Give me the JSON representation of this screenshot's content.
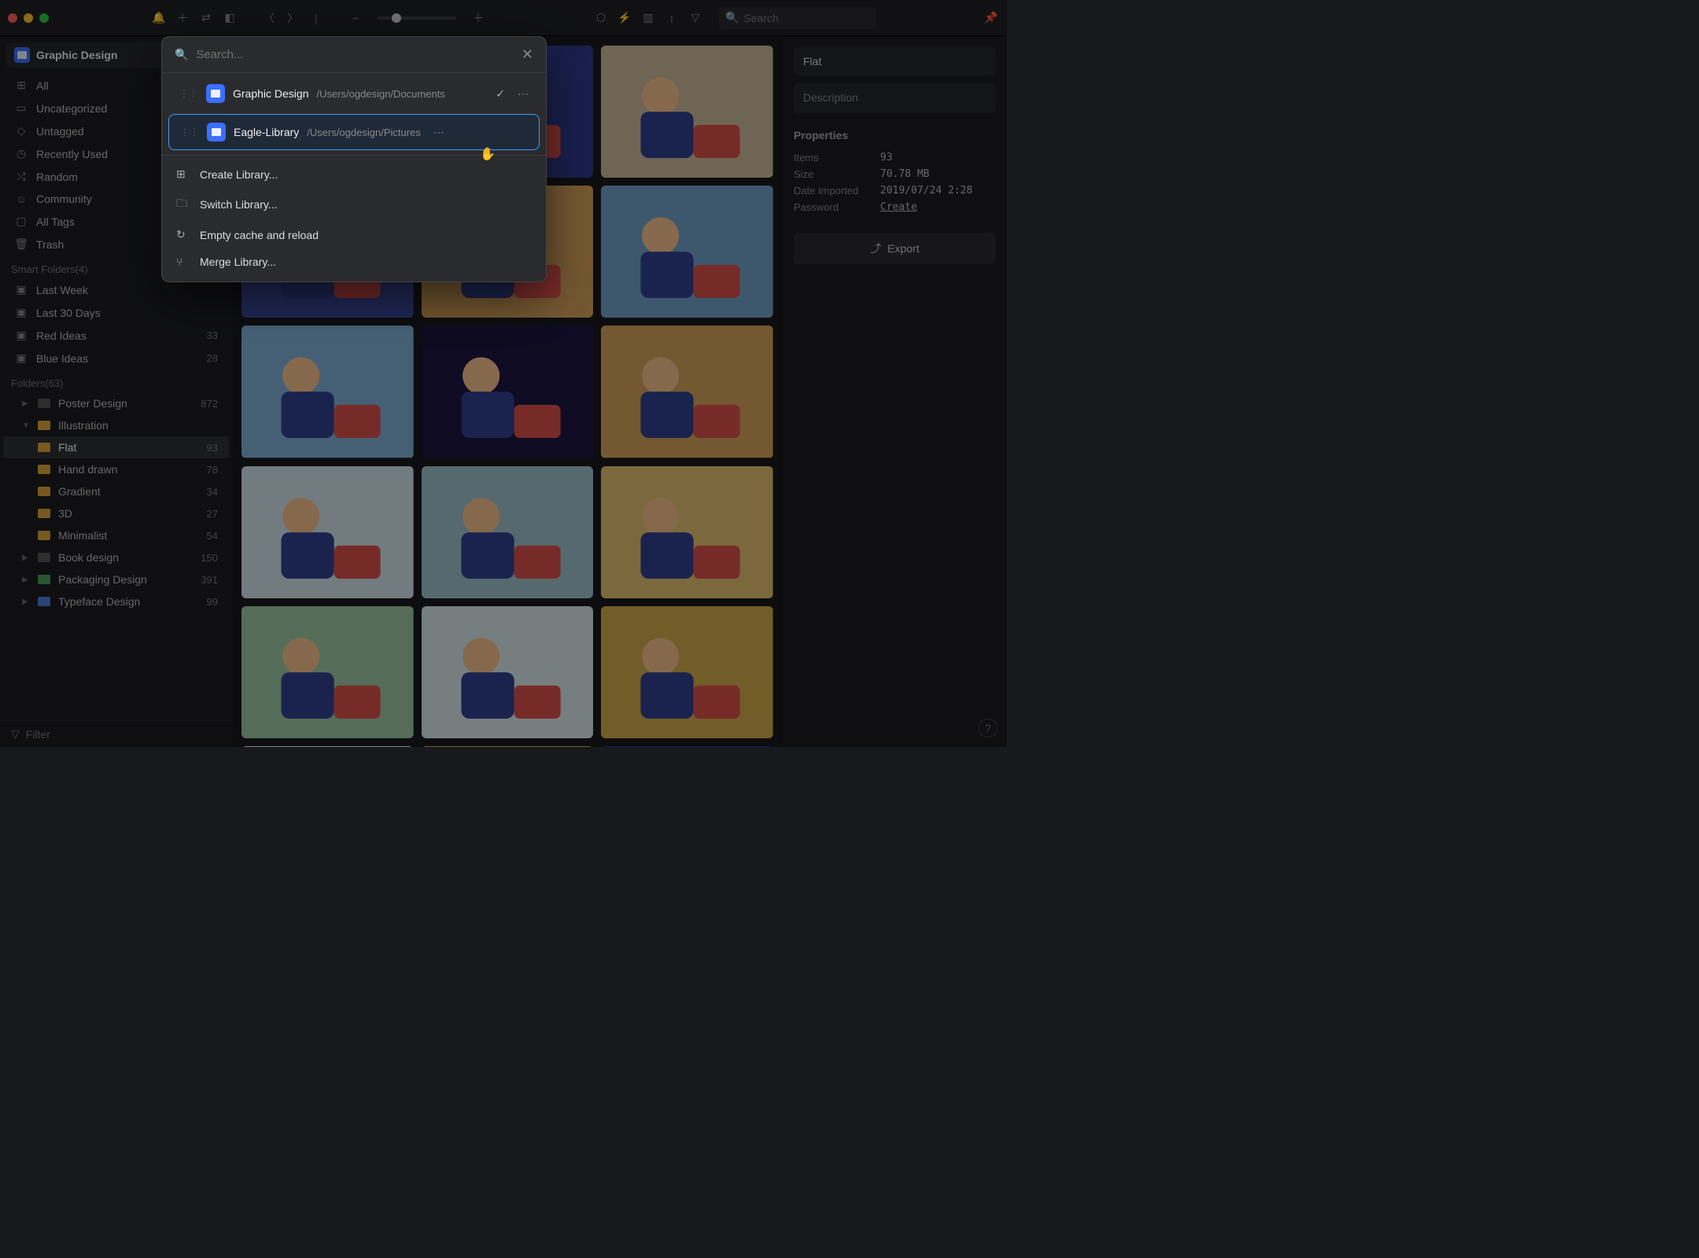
{
  "toolbar": {
    "search_placeholder": "Search"
  },
  "library": {
    "current": "Graphic Design"
  },
  "sidebar": {
    "fixed": [
      {
        "icon": "⊞",
        "label": "All"
      },
      {
        "icon": "▭",
        "label": "Uncategorized"
      },
      {
        "icon": "◇",
        "label": "Untagged"
      },
      {
        "icon": "◷",
        "label": "Recently Used"
      },
      {
        "icon": "⤮",
        "label": "Random"
      },
      {
        "icon": "☺",
        "label": "Community"
      },
      {
        "icon": "▢",
        "label": "All Tags"
      },
      {
        "icon": "🗑",
        "label": "Trash"
      }
    ],
    "smart_header": "Smart Folders(4)",
    "smart": [
      {
        "label": "Last Week",
        "count": ""
      },
      {
        "label": "Last 30 Days",
        "count": ""
      },
      {
        "label": "Red Ideas",
        "count": "33"
      },
      {
        "label": "Blue Ideas",
        "count": "28"
      }
    ],
    "folders_header": "Folders(63)",
    "folders": [
      {
        "label": "Poster Design",
        "count": "872",
        "color": "fc-grey",
        "expandable": true
      },
      {
        "label": "Illustration",
        "count": "",
        "color": "fc-orange",
        "expandable": true,
        "open": true
      },
      {
        "label": "Flat",
        "count": "93",
        "color": "fc-orange",
        "sub": true,
        "selected": true
      },
      {
        "label": "Hand drawn",
        "count": "78",
        "color": "fc-orange",
        "sub": true
      },
      {
        "label": "Gradient",
        "count": "34",
        "color": "fc-orange",
        "sub": true
      },
      {
        "label": "3D",
        "count": "27",
        "color": "fc-orange",
        "sub": true
      },
      {
        "label": "Minimalist",
        "count": "54",
        "color": "fc-orange",
        "sub": true
      },
      {
        "label": "Book design",
        "count": "150",
        "color": "fc-grey",
        "expandable": true
      },
      {
        "label": "Packaging Design",
        "count": "391",
        "color": "fc-green",
        "expandable": true
      },
      {
        "label": "Typeface Design",
        "count": "99",
        "color": "fc-blue",
        "expandable": true
      }
    ],
    "filter_placeholder": "Filter"
  },
  "inspector": {
    "title": "Flat",
    "description_placeholder": "Description",
    "section": "Properties",
    "props": [
      {
        "label": "Items",
        "value": "93"
      },
      {
        "label": "Size",
        "value": "70.78 MB"
      },
      {
        "label": "Date Imported",
        "value": "2019/07/24 2:28"
      },
      {
        "label": "Password",
        "value": "Create",
        "link": true
      }
    ],
    "export": "Export"
  },
  "popover": {
    "search_placeholder": "Search...",
    "libraries": [
      {
        "name": "Graphic Design",
        "path": "/Users/ogdesign/Documents",
        "checked": true
      },
      {
        "name": "Eagle-Library",
        "path": "/Users/ogdesign/Pictures",
        "highlight": true
      }
    ],
    "actions": [
      {
        "icon": "⊞",
        "label": "Create Library..."
      },
      {
        "icon": "🗀",
        "label": "Switch Library..."
      },
      {
        "icon": "↻",
        "label": "Empty cache and reload"
      },
      {
        "icon": "⑂",
        "label": "Merge Library..."
      }
    ]
  },
  "thumb_colors": [
    "#c77a8f",
    "#2e3a8f",
    "#cbb89b",
    "#3c4a9f",
    "#d4a05a",
    "#6fa0c7",
    "#7fb0d6",
    "#1a1440",
    "#d4a05a",
    "#d0e0e8",
    "#9bbfc9",
    "#e0c070",
    "#9bc7a0",
    "#d8e6ea",
    "#cfa84a",
    "#d8e6ea",
    "#d4a05a",
    "#2e3a8f"
  ]
}
